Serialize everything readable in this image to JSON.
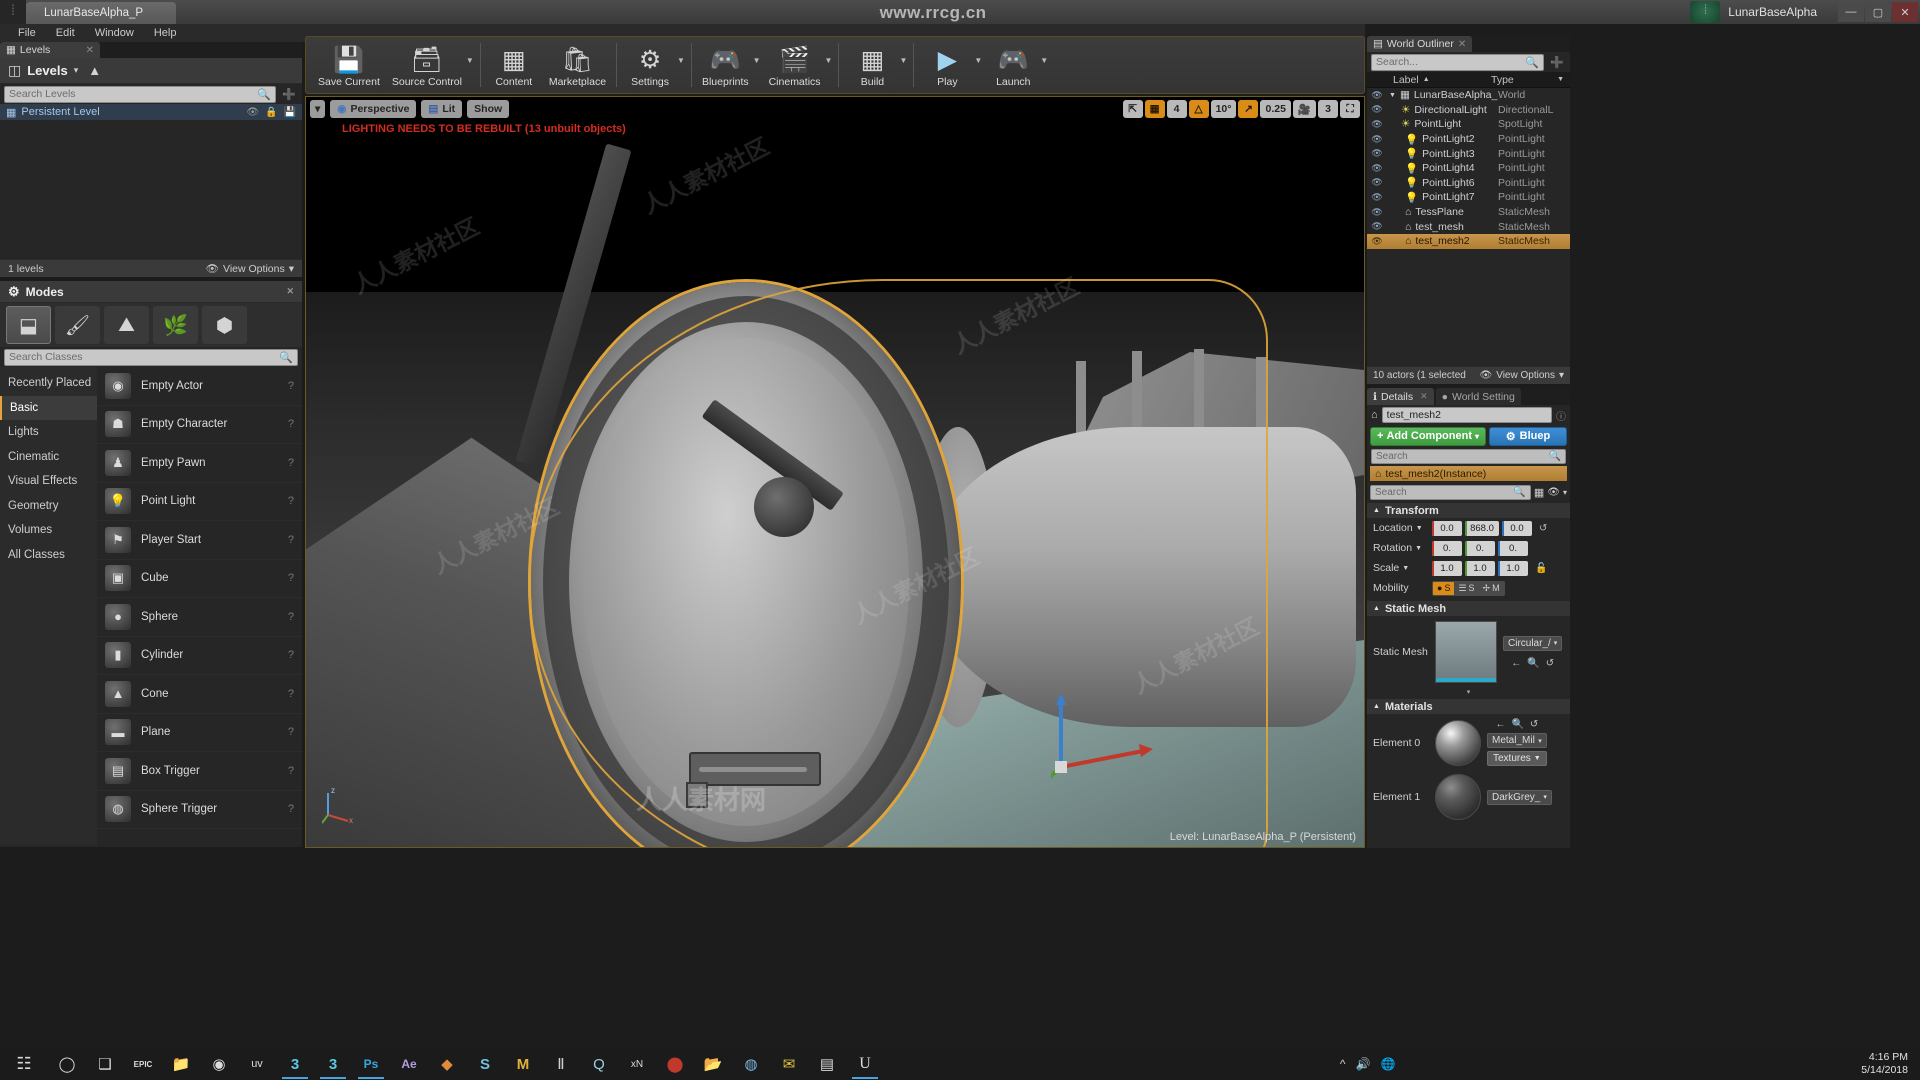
{
  "titlebar": {
    "logo_icon": "unreal-logo-icon",
    "project_tab": "LunarBaseAlpha_P",
    "center_text": "www.rrcg.cn",
    "app_name": "LunarBaseAlpha",
    "badge_icon": "unreal-badge-icon",
    "minimize": "—",
    "maximize": "▢",
    "close": "✕"
  },
  "menubar": {
    "items": [
      "File",
      "Edit",
      "Window",
      "Help"
    ]
  },
  "levels": {
    "tab_label": "Levels",
    "tab_icon": "levels-icon",
    "tab_close": "✕",
    "header_title": "Levels",
    "header_caret": "▾",
    "header_icon": "levels-stack-icon",
    "search_placeholder": "Search Levels",
    "search_icon": "search-icon",
    "add_icon": "add-level-icon",
    "persistent_level": "Persistent Level",
    "level_icon": "level-icon",
    "footer_count": "1 levels",
    "view_options": "View Options",
    "view_options_icon": "eye-icon",
    "view_options_caret": "▾"
  },
  "modes": {
    "title": "Modes",
    "title_icon": "modes-icon",
    "tools": [
      {
        "name": "place-mode",
        "glyph": "⬓",
        "active": true
      },
      {
        "name": "paint-mode",
        "glyph": "🖌",
        "active": false
      },
      {
        "name": "landscape-mode",
        "glyph": "⛰",
        "active": false
      },
      {
        "name": "foliage-mode",
        "glyph": "🌿",
        "active": false
      },
      {
        "name": "geometry-edit-mode",
        "glyph": "⬢",
        "active": false
      }
    ],
    "search_placeholder": "Search Classes",
    "search_icon": "search-icon",
    "categories": [
      {
        "label": "Recently Placed",
        "active": false
      },
      {
        "label": "Basic",
        "active": true
      },
      {
        "label": "Lights",
        "active": false
      },
      {
        "label": "Cinematic",
        "active": false
      },
      {
        "label": "Visual Effects",
        "active": false
      },
      {
        "label": "Geometry",
        "active": false
      },
      {
        "label": "Volumes",
        "active": false
      },
      {
        "label": "All Classes",
        "active": false
      }
    ],
    "items": [
      {
        "label": "Empty Actor",
        "glyph": "◉",
        "help": "?"
      },
      {
        "label": "Empty Character",
        "glyph": "☗",
        "help": "?"
      },
      {
        "label": "Empty Pawn",
        "glyph": "♟",
        "help": "?"
      },
      {
        "label": "Point Light",
        "glyph": "💡",
        "help": "?"
      },
      {
        "label": "Player Start",
        "glyph": "⚑",
        "help": "?"
      },
      {
        "label": "Cube",
        "glyph": "▣",
        "help": "?"
      },
      {
        "label": "Sphere",
        "glyph": "●",
        "help": "?"
      },
      {
        "label": "Cylinder",
        "glyph": "▮",
        "help": "?"
      },
      {
        "label": "Cone",
        "glyph": "▲",
        "help": "?"
      },
      {
        "label": "Plane",
        "glyph": "▬",
        "help": "?"
      },
      {
        "label": "Box Trigger",
        "glyph": "▤",
        "help": "?"
      },
      {
        "label": "Sphere Trigger",
        "glyph": "◍",
        "help": "?"
      }
    ]
  },
  "toolbar": {
    "items": [
      {
        "label": "Save Current",
        "icon": "save-icon",
        "glyph": "💾",
        "caret": false
      },
      {
        "label": "Source Control",
        "icon": "source-control-icon",
        "glyph": "🗂",
        "caret": true
      },
      {
        "label": "Content",
        "icon": "content-browser-icon",
        "glyph": "▦",
        "caret": false
      },
      {
        "label": "Marketplace",
        "icon": "marketplace-icon",
        "glyph": "🛍",
        "caret": false
      },
      {
        "label": "Settings",
        "icon": "settings-gear-icon",
        "glyph": "⚙",
        "caret": true
      },
      {
        "label": "Blueprints",
        "icon": "blueprints-icon",
        "glyph": "🎮",
        "caret": true
      },
      {
        "label": "Cinematics",
        "icon": "cinematics-icon",
        "glyph": "🎬",
        "caret": true
      },
      {
        "label": "Build",
        "icon": "build-icon",
        "glyph": "⬔",
        "caret": true
      },
      {
        "label": "Play",
        "icon": "play-icon",
        "glyph": "▶",
        "caret": true
      },
      {
        "label": "Launch",
        "icon": "launch-icon",
        "glyph": "🎮",
        "caret": true
      }
    ]
  },
  "viewport": {
    "view_menu_caret": "▾",
    "perspective": "Perspective",
    "perspective_icon": "camera-icon",
    "lit": "Lit",
    "lit_icon": "lit-sphere-icon",
    "show": "Show",
    "warning": "LIGHTING NEEDS TO BE REBUILT (13 unbuilt objects)",
    "level_status": "Level:  LunarBaseAlpha_P (Persistent)",
    "axis_x": "x",
    "axis_y": "y",
    "axis_z": "z",
    "snap_controls": [
      {
        "name": "surface-snap-toggle",
        "glyph": "⇱",
        "label": "",
        "active": false
      },
      {
        "name": "grid-snap-toggle",
        "glyph": "▦",
        "label": "",
        "active": true
      },
      {
        "name": "grid-snap-value",
        "glyph": "",
        "label": "4",
        "active": false
      },
      {
        "name": "rotation-snap-toggle",
        "glyph": "△",
        "label": "",
        "active": true
      },
      {
        "name": "rotation-snap-value",
        "glyph": "",
        "label": "10°",
        "active": false
      },
      {
        "name": "scale-snap-toggle",
        "glyph": "↗",
        "label": "",
        "active": true
      },
      {
        "name": "scale-snap-value",
        "glyph": "",
        "label": "0.25",
        "active": false
      },
      {
        "name": "camera-speed-icon",
        "glyph": "🎥",
        "label": "",
        "active": false
      },
      {
        "name": "camera-speed-value",
        "glyph": "",
        "label": "3",
        "active": false
      },
      {
        "name": "maximize-viewport-toggle",
        "glyph": "⛶",
        "label": "",
        "active": false
      }
    ]
  },
  "world_outliner": {
    "tab_label": "World Outliner",
    "tab_icon": "outliner-icon",
    "tab_close": "✕",
    "search_placeholder": "Search...",
    "search_icon": "search-icon",
    "add_icon": "add-icon",
    "col_label": "Label",
    "col_type": "Type",
    "sort_caret": "▲",
    "filter_caret": "▼",
    "rows": [
      {
        "label": "LunarBaseAlpha_P (E",
        "type": "World",
        "icon": "world-icon",
        "depth": 0,
        "selected": false
      },
      {
        "label": "DirectionalLight",
        "type": "DirectionalL",
        "icon": "directional-light-icon",
        "depth": 1,
        "selected": false
      },
      {
        "label": "PointLight",
        "type": "SpotLight",
        "icon": "spot-light-icon",
        "depth": 1,
        "selected": false
      },
      {
        "label": "PointLight2",
        "type": "PointLight",
        "icon": "point-light-icon",
        "depth": 1,
        "selected": false
      },
      {
        "label": "PointLight3",
        "type": "PointLight",
        "icon": "point-light-icon",
        "depth": 1,
        "selected": false
      },
      {
        "label": "PointLight4",
        "type": "PointLight",
        "icon": "point-light-icon",
        "depth": 1,
        "selected": false
      },
      {
        "label": "PointLight6",
        "type": "PointLight",
        "icon": "point-light-icon",
        "depth": 1,
        "selected": false
      },
      {
        "label": "PointLight7",
        "type": "PointLight",
        "icon": "point-light-icon",
        "depth": 1,
        "selected": false
      },
      {
        "label": "TessPlane",
        "type": "StaticMesh",
        "icon": "static-mesh-icon",
        "depth": 1,
        "selected": false
      },
      {
        "label": "test_mesh",
        "type": "StaticMesh",
        "icon": "static-mesh-icon",
        "depth": 1,
        "selected": false
      },
      {
        "label": "test_mesh2",
        "type": "StaticMesh",
        "icon": "static-mesh-icon",
        "depth": 1,
        "selected": true
      }
    ],
    "footer_count": "10 actors (1 selected",
    "view_options": "View Options",
    "view_options_icon": "eye-icon",
    "view_options_caret": "▾"
  },
  "details": {
    "tab_details": "Details",
    "tab_details_icon": "details-icon",
    "tab_close": "✕",
    "tab_world_settings": "World Setting",
    "tab_world_icon": "world-settings-icon",
    "actor_name": "test_mesh2",
    "actor_icon": "static-mesh-icon",
    "add_component": "Add Component",
    "add_component_plus": "+",
    "add_component_caret": "▾",
    "blueprint_button": "Bluep",
    "blueprint_icon": "blueprint-gear-icon",
    "component_search_placeholder": "Search",
    "component_row": "test_mesh2(Instance)",
    "component_icon": "static-mesh-icon",
    "props_search_placeholder": "Search",
    "grid_view_icon": "grid-view-icon",
    "eye_icon": "eye-icon",
    "caret_icon": "▾",
    "sections": {
      "transform": {
        "title": "Transform",
        "caret": "▲",
        "location_label": "Location",
        "location": [
          "0.0",
          "868.0",
          "0.0"
        ],
        "rotation_label": "Rotation",
        "rotation": [
          "0.",
          "0.",
          "0."
        ],
        "scale_label": "Scale",
        "scale": [
          "1.0",
          "1.0",
          "1.0"
        ],
        "mobility_label": "Mobility",
        "mobility_options": [
          {
            "label": "S",
            "icon": "static-icon",
            "active": true
          },
          {
            "label": "S",
            "icon": "stationary-icon",
            "active": false
          },
          {
            "label": "M",
            "icon": "movable-icon",
            "active": false
          }
        ],
        "reset_icon": "reset-arrow-icon",
        "lock_icon": "lock-icon"
      },
      "static_mesh": {
        "title": "Static Mesh",
        "caret": "▲",
        "label": "Static Mesh",
        "asset_name": "Circular_/",
        "asset_caret": "▾",
        "nav_icons": [
          "back-arrow-icon",
          "browse-icon",
          "reset-arrow-icon"
        ],
        "expand_caret": "▾"
      },
      "materials": {
        "title": "Materials",
        "caret": "▲",
        "elements": [
          {
            "label": "Element 0",
            "material": "Metal_Mil",
            "caret": "▾",
            "textures_button": "Textures",
            "nav_icons": [
              "back-arrow-icon",
              "browse-icon",
              "reset-arrow-icon"
            ]
          },
          {
            "label": "Element 1",
            "material": "DarkGrey_",
            "caret": "▾",
            "textures_button": "",
            "nav_icons": []
          }
        ]
      }
    }
  },
  "taskbar": {
    "start_icon": "windows-start-icon",
    "icons": [
      {
        "name": "cortana-search-icon",
        "glyph": "◯"
      },
      {
        "name": "task-view-icon",
        "glyph": "❑"
      },
      {
        "name": "epic-launcher-icon",
        "glyph": "EPIC"
      },
      {
        "name": "file-explorer-icon",
        "glyph": "📁"
      },
      {
        "name": "chrome-icon",
        "glyph": "◉"
      },
      {
        "name": "uv-tool-icon",
        "glyph": "uv"
      },
      {
        "name": "3dsmax-icon",
        "glyph": "3"
      },
      {
        "name": "3dsmax2-icon",
        "glyph": "3"
      },
      {
        "name": "photoshop-icon",
        "glyph": "Ps"
      },
      {
        "name": "aftereffects-icon",
        "glyph": "Ae"
      },
      {
        "name": "substance-icon",
        "glyph": "◆"
      },
      {
        "name": "substance-designer-icon",
        "glyph": "S"
      },
      {
        "name": "marmoset-icon",
        "glyph": "M"
      },
      {
        "name": "zbrush-icon",
        "glyph": "Ⅱ"
      },
      {
        "name": "quixel-icon",
        "glyph": "Q"
      },
      {
        "name": "xnormal-icon",
        "glyph": "xN"
      },
      {
        "name": "record-icon",
        "glyph": "⬤"
      },
      {
        "name": "explorer2-icon",
        "glyph": "📂"
      },
      {
        "name": "browser-icon",
        "glyph": "◍"
      },
      {
        "name": "mail-icon",
        "glyph": "✉"
      },
      {
        "name": "notepad-icon",
        "glyph": "▤"
      },
      {
        "name": "unreal-taskbar-icon",
        "glyph": "U"
      }
    ],
    "sys_icons": [
      "^",
      "🔊",
      "🌐"
    ],
    "time": "4:16 PM",
    "date": "5/14/2018"
  },
  "watermarks": {
    "diagonal": "人人素材社区",
    "center": "人人素材网"
  },
  "colors": {
    "accent_orange": "#d98c18",
    "selection": "#e0a53a",
    "green_button": "#4caf50",
    "blue_button": "#2874b4",
    "warning_red": "#d42c22"
  }
}
